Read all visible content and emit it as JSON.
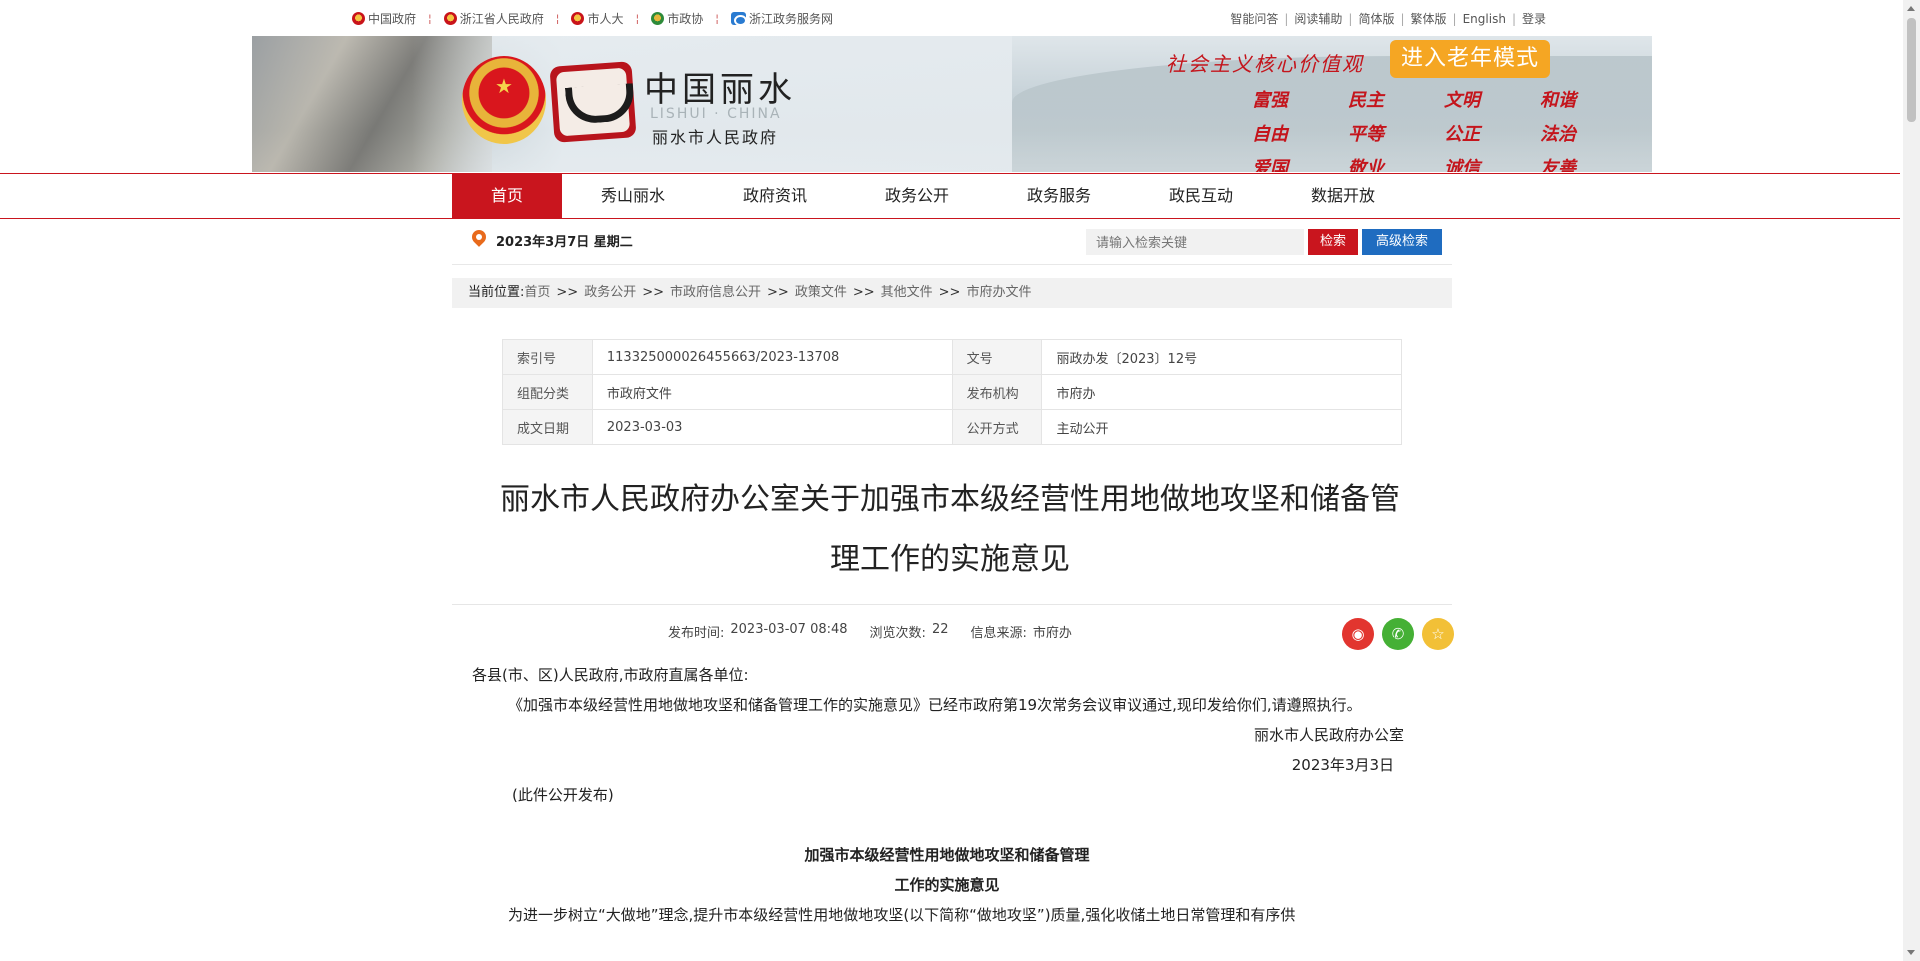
{
  "topbar": {
    "left_links": [
      "中国政府",
      "浙江省人民政府",
      "市人大",
      "市政协",
      "浙江政务服务网"
    ],
    "right_links": [
      "智能问答",
      "阅读辅助",
      "简体版",
      "繁体版",
      "English",
      "登录"
    ]
  },
  "banner": {
    "site_title": "中国丽水",
    "site_sub_en": "LISHUI · CHINA",
    "site_sub": "丽水市人民政府",
    "values_title": "社会主义核心价值观",
    "elder_mode": "进入老年模式",
    "values": [
      "富强",
      "民主",
      "文明",
      "和谐",
      "自由",
      "平等",
      "公正",
      "法治",
      "爱国",
      "敬业",
      "诚信",
      "友善"
    ],
    "accent_color": "#c9151e"
  },
  "nav": [
    "首页",
    "秀山丽水",
    "政府资讯",
    "政务公开",
    "政务服务",
    "政民互动",
    "数据开放"
  ],
  "date_text": "2023年3月7日 星期二",
  "search": {
    "placeholder": "请输入检索关键",
    "search_label": "检索",
    "advanced_label": "高级检索"
  },
  "breadcrumb": {
    "label": "当前位置:",
    "items": [
      "首页",
      "政务公开",
      "市政府信息公开",
      "政策文件",
      "其他文件",
      "市府办文件"
    ]
  },
  "info": {
    "rows": [
      {
        "k1": "索引号",
        "v1": "113325000026455663/2023-13708",
        "k2": "文号",
        "v2": "丽政办发〔2023〕12号"
      },
      {
        "k1": "组配分类",
        "v1": "市政府文件",
        "k2": "发布机构",
        "v2": "市府办"
      },
      {
        "k1": "成文日期",
        "v1": "2023-03-03",
        "k2": "公开方式",
        "v2": "主动公开"
      }
    ]
  },
  "doc_title": "丽水市人民政府办公室关于加强市本级经营性用地做地攻坚和储备管理工作的实施意见",
  "meta": {
    "publish_label": "发布时间:",
    "publish_time": "2023-03-07 08:48",
    "views_label": "浏览次数:",
    "views": "22",
    "source_label": "信息来源:",
    "source": "市府办"
  },
  "body": {
    "greeting": "各县(市、区)人民政府,市政府直属各单位:",
    "p1": "《加强市本级经营性用地做地攻坚和储备管理工作的实施意见》已经市政府第19次常务会议审议通过,现印发给你们,请遵照执行。",
    "signer": "丽水市人民政府办公室",
    "sign_date": "2023年3月3日",
    "public_note": "(此件公开发布)",
    "heading1": "加强市本级经营性用地做地攻坚和储备管理",
    "heading2": "工作的实施意见",
    "p2": "为进一步树立“大做地”理念,提升市本级经营性用地做地攻坚(以下简称“做地攻坚”)质量,强化收储土地日常管理和有序供"
  }
}
